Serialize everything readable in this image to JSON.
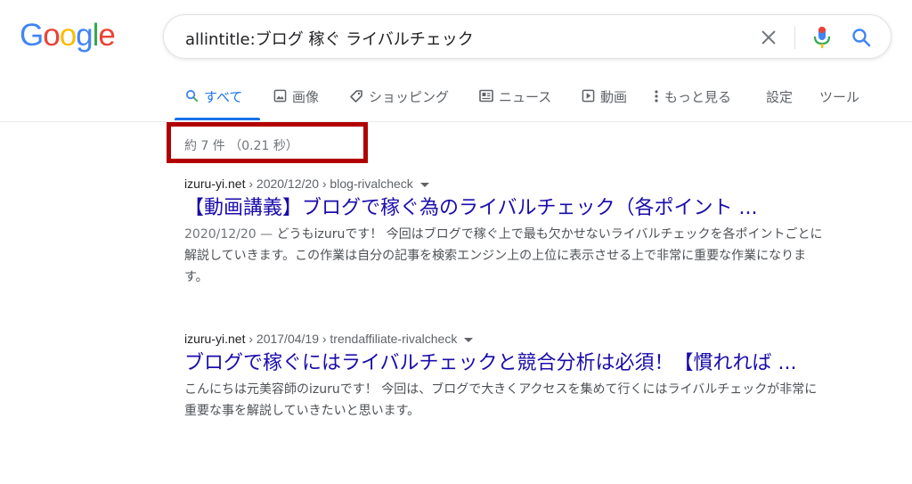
{
  "logo": {
    "letters": [
      {
        "ch": "G",
        "color": "#4285f4"
      },
      {
        "ch": "o",
        "color": "#ea4335"
      },
      {
        "ch": "o",
        "color": "#fbbc05"
      },
      {
        "ch": "g",
        "color": "#4285f4"
      },
      {
        "ch": "l",
        "color": "#34a853"
      },
      {
        "ch": "e",
        "color": "#ea4335"
      }
    ]
  },
  "search": {
    "query": "allintitle:ブログ  稼ぐ ライバルチェック"
  },
  "tabs": [
    {
      "label": "すべて",
      "icon": "search-icon",
      "active": true
    },
    {
      "label": "画像",
      "icon": "image-icon",
      "active": false
    },
    {
      "label": "ショッピング",
      "icon": "tag-icon",
      "active": false
    },
    {
      "label": "ニュース",
      "icon": "news-icon",
      "active": false
    },
    {
      "label": "動画",
      "icon": "video-icon",
      "active": false
    },
    {
      "label": "もっと見る",
      "icon": "more-vert-icon",
      "active": false
    },
    {
      "label": "設定",
      "active": false
    },
    {
      "label": "ツール",
      "active": false
    }
  ],
  "stats": {
    "text": "約 7 件 （0.21 秒）"
  },
  "colors": {
    "link": "#1a0dab",
    "accent": "#1a73e8",
    "annotation": "#b20000"
  },
  "results": [
    {
      "site": "izuru-yi.net",
      "path": " › 2020/12/20 › blog-rivalcheck",
      "title": "【動画講義】ブログで稼ぐ為のライバルチェック（各ポイント ...",
      "date": "2020/12/20 — ",
      "snippet": "どうもizuruです！ 今回はブログで稼ぐ上で最も欠かせないライバルチェックを各ポイントごとに解説していきます。この作業は自分の記事を検索エンジン上の上位に表示させる上で非常に重要な作業になります。"
    },
    {
      "site": "izuru-yi.net",
      "path": " › 2017/04/19 › trendaffiliate-rivalcheck",
      "title": "ブログで稼ぐにはライバルチェックと競合分析は必須！【慣れれば ...",
      "date": "",
      "snippet": "こんにちは元美容師のizuruです！ 今回は、ブログで大きくアクセスを集めて行くにはライバルチェックが非常に重要な事を解説していきたいと思います。"
    }
  ]
}
